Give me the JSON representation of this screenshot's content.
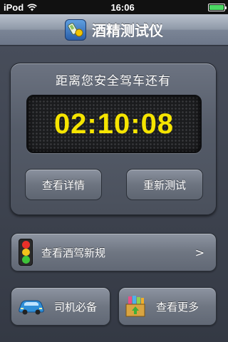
{
  "status_bar": {
    "carrier": "iPod",
    "time": "16:06",
    "icons": [
      "wifi-icon",
      "battery-icon"
    ]
  },
  "nav": {
    "title": "酒精测试仪",
    "icon": "app-logo-icon"
  },
  "timer_panel": {
    "label": "距离您安全驾车还有",
    "countdown": "02:10:08",
    "details_button": "查看详情",
    "retest_button": "重新测试"
  },
  "rules_button": {
    "label": "查看酒驾新规",
    "icon": "traffic-light-icon",
    "chevron": ">"
  },
  "driver_button": {
    "label": "司机必备",
    "icon": "car-icon"
  },
  "more_button": {
    "label": "查看更多",
    "icon": "gift-box-icon"
  },
  "colors": {
    "countdown": "#f5e400",
    "background": "#3a3f4b"
  }
}
